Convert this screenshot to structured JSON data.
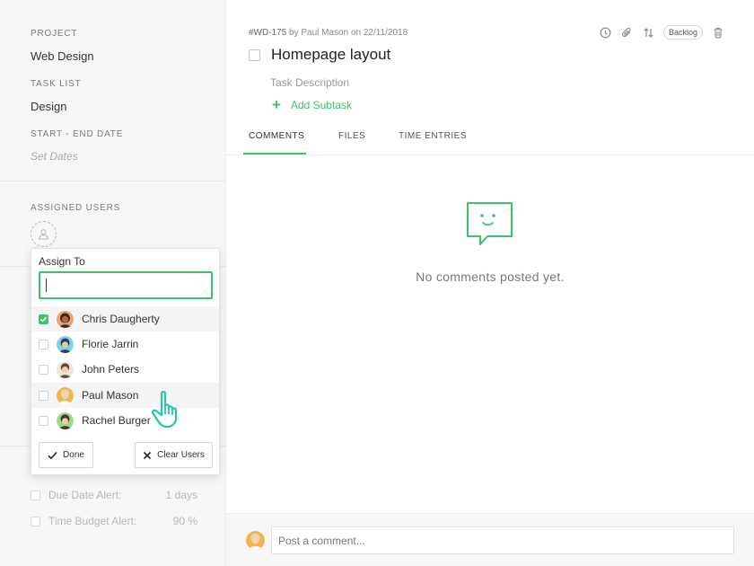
{
  "sidebar": {
    "project_label": "PROJECT",
    "project_value": "Web Design",
    "tasklist_label": "TASK LIST",
    "tasklist_value": "Design",
    "dates_label": "START - END DATE",
    "dates_value": "Set Dates",
    "assigned_label": "ASSIGNED USERS",
    "alerts": [
      {
        "label": "Due Date Alert:",
        "value": "1 days"
      },
      {
        "label": "Time Budget Alert:",
        "value": "90 %"
      }
    ]
  },
  "assign_popover": {
    "title": "Assign To",
    "search_value": "",
    "users": [
      {
        "name": "Chris Daugherty",
        "checked": true
      },
      {
        "name": "Florie Jarrin",
        "checked": false
      },
      {
        "name": "John Peters",
        "checked": false
      },
      {
        "name": "Paul Mason",
        "checked": false
      },
      {
        "name": "Rachel Burger",
        "checked": false
      }
    ],
    "done_label": "Done",
    "clear_label": "Clear Users"
  },
  "task": {
    "id": "#WD-175",
    "meta_by": " by Paul Mason on 22/11/2018",
    "title": "Homepage layout",
    "description_placeholder": "Task Description",
    "add_subtask_label": "Add Subtask",
    "status_badge": "Backlog"
  },
  "tabs": [
    {
      "label": "COMMENTS",
      "active": true
    },
    {
      "label": "FILES",
      "active": false
    },
    {
      "label": "TIME ENTRIES",
      "active": false
    }
  ],
  "comments": {
    "empty_text": "No comments posted yet.",
    "input_placeholder": "Post a comment..."
  },
  "colors": {
    "accent": "#3cc466",
    "cursor": "#26c6a6"
  }
}
